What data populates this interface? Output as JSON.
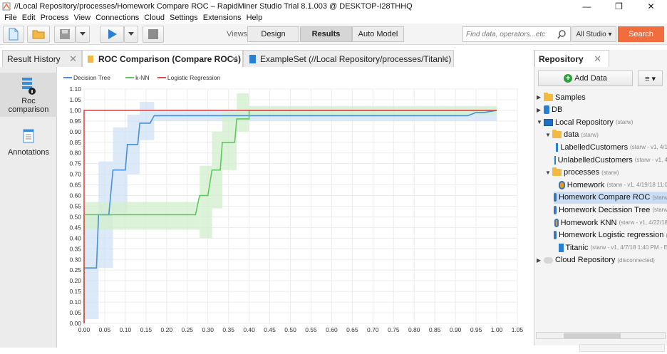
{
  "window": {
    "title": "//Local Repository/processes/Homework Compare ROC – RapidMiner Studio Trial 8.1.003 @ DESKTOP-I28THHQ",
    "minimize": "—",
    "maximize": "❐",
    "close": "✕"
  },
  "menu": [
    "File",
    "Edit",
    "Process",
    "View",
    "Connections",
    "Cloud",
    "Settings",
    "Extensions",
    "Help"
  ],
  "toolbar": {
    "views_label": "Views:",
    "views": [
      "Design",
      "Results",
      "Auto Model"
    ],
    "active_view": "Results",
    "search_placeholder": "Find data, operators...etc",
    "scope": "All Studio ▾",
    "search_button": "Search"
  },
  "tabs": [
    {
      "label": "Result History",
      "close": "✕"
    },
    {
      "label": "ROC Comparison (Compare ROCs)",
      "close": "✕"
    },
    {
      "label": "ExampleSet (//Local Repository/processes/Titanic)",
      "close": "✕"
    }
  ],
  "side_panel": {
    "items": [
      "Roc comparison",
      "Annotations"
    ]
  },
  "chart_data": {
    "type": "line",
    "title": "",
    "xlabel": "",
    "ylabel": "",
    "xlim": [
      0.0,
      1.05
    ],
    "ylim": [
      0.0,
      1.1
    ],
    "xticks": [
      "0.00",
      "0.05",
      "0.10",
      "0.15",
      "0.20",
      "0.25",
      "0.30",
      "0.35",
      "0.40",
      "0.45",
      "0.50",
      "0.55",
      "0.60",
      "0.65",
      "0.70",
      "0.75",
      "0.80",
      "0.85",
      "0.90",
      "0.95",
      "1.00",
      "1.05"
    ],
    "yticks": [
      "0.00",
      "0.05",
      "0.10",
      "0.15",
      "0.20",
      "0.25",
      "0.30",
      "0.35",
      "0.40",
      "0.45",
      "0.50",
      "0.55",
      "0.60",
      "0.65",
      "0.70",
      "0.75",
      "0.80",
      "0.85",
      "0.90",
      "0.95",
      "1.00",
      "1.05",
      "1.10"
    ],
    "grid": true,
    "legend": "top-left",
    "series": [
      {
        "name": "Decision Tree",
        "color": "#4a8fd8",
        "band_color": "#cfe1f5",
        "points": [
          [
            0,
            0
          ],
          [
            0,
            0.26
          ],
          [
            0.03,
            0.26
          ],
          [
            0.035,
            0.51
          ],
          [
            0.06,
            0.51
          ],
          [
            0.07,
            0.72
          ],
          [
            0.1,
            0.72
          ],
          [
            0.105,
            0.84
          ],
          [
            0.13,
            0.84
          ],
          [
            0.135,
            0.94
          ],
          [
            0.16,
            0.94
          ],
          [
            0.17,
            0.975
          ],
          [
            0.93,
            0.975
          ],
          [
            0.95,
            0.99
          ],
          [
            0.97,
            0.99
          ],
          [
            1.0,
            1.0
          ]
        ],
        "band": [
          [
            0,
            0.02,
            0.5
          ],
          [
            0.035,
            0.26,
            0.76
          ],
          [
            0.07,
            0.52,
            0.92
          ],
          [
            0.105,
            0.7,
            0.98
          ],
          [
            0.135,
            0.86,
            1.04
          ],
          [
            0.17,
            0.95,
            1.0
          ],
          [
            0.93,
            0.95,
            1.0
          ],
          [
            1.0,
            0.99,
            1.01
          ]
        ]
      },
      {
        "name": "k-NN",
        "color": "#5cc95c",
        "band_color": "#d2efcc",
        "points": [
          [
            0,
            0
          ],
          [
            0,
            0.51
          ],
          [
            0.27,
            0.51
          ],
          [
            0.28,
            0.6
          ],
          [
            0.3,
            0.6
          ],
          [
            0.31,
            0.72
          ],
          [
            0.33,
            0.72
          ],
          [
            0.335,
            0.85
          ],
          [
            0.365,
            0.85
          ],
          [
            0.37,
            0.96
          ],
          [
            0.4,
            0.96
          ],
          [
            0.4,
            1.0
          ],
          [
            1.0,
            1.0
          ]
        ],
        "band": [
          [
            0,
            0.44,
            0.57
          ],
          [
            0.27,
            0.44,
            0.57
          ],
          [
            0.28,
            0.4,
            0.74
          ],
          [
            0.31,
            0.54,
            0.9
          ],
          [
            0.335,
            0.72,
            0.99
          ],
          [
            0.37,
            0.9,
            1.08
          ],
          [
            0.4,
            0.98,
            1.02
          ],
          [
            1.0,
            0.99,
            1.01
          ]
        ]
      },
      {
        "name": "Logistic Regression",
        "color": "#e04848",
        "band_color": "#f7d2d2",
        "points": [
          [
            0,
            0
          ],
          [
            0,
            1.0
          ],
          [
            1.0,
            1.0
          ]
        ],
        "band": []
      }
    ]
  },
  "repository": {
    "title": "Repository",
    "close": "✕",
    "add_data": "Add Data",
    "menu_button": "≡ ▾",
    "tree": [
      {
        "level": 0,
        "arrow": "▶",
        "icon": "folder-icon",
        "name": "Samples",
        "meta": ""
      },
      {
        "level": 0,
        "arrow": "▶",
        "icon": "database-icon",
        "name": "DB",
        "meta": ""
      },
      {
        "level": 0,
        "arrow": "▼",
        "icon": "computer-icon",
        "name": "Local Repository",
        "meta": "(starw)"
      },
      {
        "level": 1,
        "arrow": "▼",
        "icon": "folder-icon",
        "name": "data",
        "meta": "(starw)"
      },
      {
        "level": 2,
        "arrow": "",
        "icon": "data-icon",
        "name": "LabelledCustomers",
        "meta": "(starw - v1, 4/1"
      },
      {
        "level": 2,
        "arrow": "",
        "icon": "data-icon",
        "name": "UnlabelledCustomers",
        "meta": "(starw - v1, 4"
      },
      {
        "level": 1,
        "arrow": "▼",
        "icon": "folder-icon",
        "name": "processes",
        "meta": "(starw)"
      },
      {
        "level": 2,
        "arrow": "",
        "icon": "process-icon",
        "name": "Homework",
        "meta": "(starw - v1, 4/19/18 11:0"
      },
      {
        "level": 2,
        "arrow": "",
        "icon": "process-icon",
        "name": "Homework Compare ROC",
        "meta": "(starw -",
        "selected": true
      },
      {
        "level": 2,
        "arrow": "",
        "icon": "process-icon",
        "name": "Homework Decission Tree",
        "meta": "(starw"
      },
      {
        "level": 2,
        "arrow": "",
        "icon": "process-icon",
        "name": "Homework KNN",
        "meta": "(starw - v1, 4/22/18"
      },
      {
        "level": 2,
        "arrow": "",
        "icon": "process-icon",
        "name": "Homework Logistic regression",
        "meta": "(s"
      },
      {
        "level": 2,
        "arrow": "",
        "icon": "data-icon",
        "name": "Titanic",
        "meta": "(starw - v1, 4/7/18 1:40 PM - E"
      },
      {
        "level": 0,
        "arrow": "▶",
        "icon": "cloud-icon",
        "name": "Cloud Repository",
        "meta": "(disconnected)"
      }
    ]
  }
}
